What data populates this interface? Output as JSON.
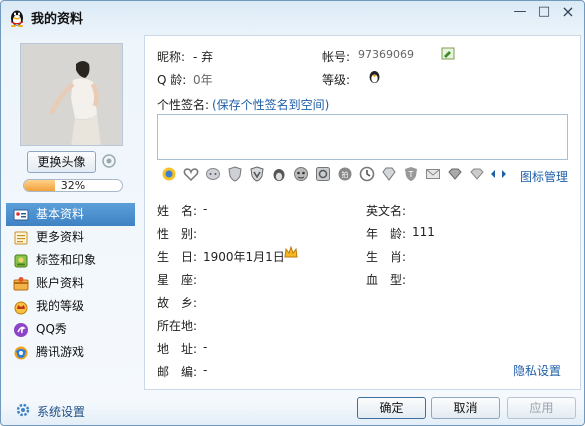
{
  "window": {
    "title": "我的资料",
    "min_label": "—",
    "max_label": "□",
    "close_label": "×"
  },
  "left": {
    "change_avatar": "更换头像",
    "progress": {
      "value": 0.32,
      "label": "32%"
    },
    "nav": [
      {
        "label": "基本资料",
        "icon": "id-card-icon",
        "active": true
      },
      {
        "label": "更多资料",
        "icon": "document-icon"
      },
      {
        "label": "标签和印象",
        "icon": "tag-icon"
      },
      {
        "label": "账户资料",
        "icon": "account-icon"
      },
      {
        "label": "我的等级",
        "icon": "crown-icon"
      },
      {
        "label": "QQ秀",
        "icon": "qqshow-icon"
      },
      {
        "label": "腾讯游戏",
        "icon": "game-icon"
      }
    ],
    "system_settings": "系统设置"
  },
  "profile": {
    "nickname_label": "昵称:",
    "nickname_value": "- 弃",
    "account_label": "帐号:",
    "account_value": "97369069",
    "age_label": "Q 龄:",
    "age_value": "0年",
    "level_label": "等级:",
    "signature_label": "个性签名:",
    "signature_link": "(保存个性签名到空间)",
    "icon_manage": "图标管理"
  },
  "details": {
    "name_label": "姓　名:",
    "name_value": "-",
    "english_label": "英文名:",
    "gender_label": "性　别:",
    "age2_label": "年　龄:",
    "age2_value": "111",
    "birthday_label": "生　日:",
    "birthday_value": "1900年1月1日",
    "zodiac_label": "生　肖:",
    "constellation_label": "星　座:",
    "blood_label": "血　型:",
    "hometown_label": "故　乡:",
    "location_label": "所在地:",
    "address_label": "地　址:",
    "address_value": "-",
    "zip_label": "邮　编:",
    "zip_value": "-",
    "privacy_link": "隐私设置"
  },
  "buttons": {
    "ok": "确定",
    "cancel": "取消",
    "apply": "应用"
  },
  "colors": {
    "accent": "#3f82c4",
    "link": "#1f5fa8"
  }
}
